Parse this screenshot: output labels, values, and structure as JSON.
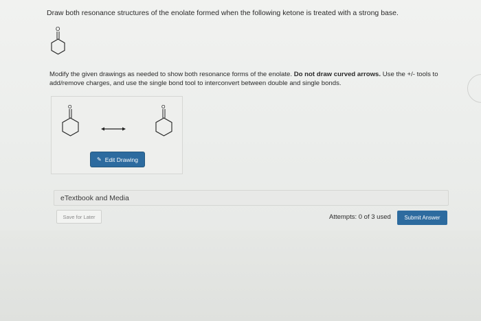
{
  "question": {
    "prompt": "Draw both resonance structures of the enolate formed when the following ketone is treated with a strong base."
  },
  "instructions": {
    "part1": "Modify the given drawings as needed to show both resonance forms of the enolate. ",
    "bold": "Do not draw curved arrows.",
    "part2": " Use the +/- tools to add/remove charges, and use the single bond tool to interconvert between double and single bonds."
  },
  "molecules": {
    "ketone_atom_label": "O",
    "left_atom_label": "O",
    "right_atom_label": "O"
  },
  "drawing": {
    "edit_label": "Edit Drawing",
    "edit_icon": "pencil-icon"
  },
  "etextbook": {
    "label": "eTextbook and Media"
  },
  "footer": {
    "save_label": "Save for Later",
    "attempts_text": "Attempts: 0 of 3 used",
    "submit_label": "Submit Answer"
  },
  "colors": {
    "primary_button": "#2d6b9f",
    "page_bg": "#eceeec"
  }
}
